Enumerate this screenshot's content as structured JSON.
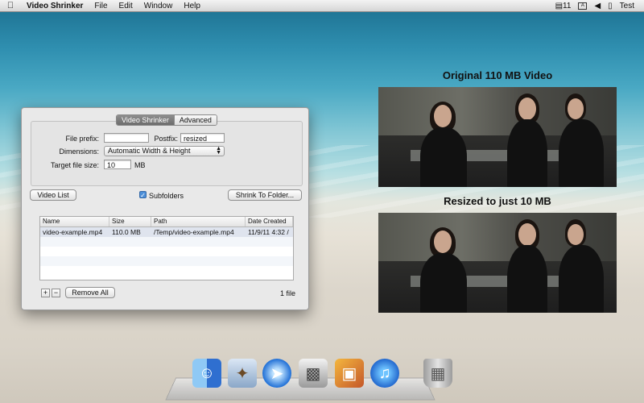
{
  "menubar": {
    "app_name": "Video Shrinker",
    "menus": [
      "File",
      "Edit",
      "Window",
      "Help"
    ],
    "status": {
      "input_label": "11",
      "user": "Test"
    }
  },
  "window": {
    "tabs": [
      "Video Shrinker",
      "Advanced"
    ],
    "active_tab": "Video Shrinker",
    "file_prefix_label": "File prefix:",
    "file_prefix_value": "",
    "postfix_label": "Postfix:",
    "postfix_value": "resized",
    "dimensions_label": "Dimensions:",
    "dimensions_value": "Automatic Width & Height",
    "target_size_label": "Target file size:",
    "target_size_value": "10",
    "target_size_unit": "MB",
    "video_list_button": "Video List",
    "subfolders_label": "Subfolders",
    "subfolders_checked": true,
    "shrink_button": "Shrink To Folder...",
    "list": {
      "columns": [
        "Name",
        "Size",
        "Path",
        "Date Created"
      ],
      "rows": [
        {
          "name": "video-example.mp4",
          "size": "110.0 MB",
          "path": "/Temp/video-example.mp4",
          "date": "11/9/11 4:32 /"
        }
      ]
    },
    "add_label": "+",
    "remove_small_label": "−",
    "remove_all_button": "Remove All",
    "file_count": "1 file"
  },
  "promo": {
    "original_caption": "Original 110 MB Video",
    "resized_caption": "Resized to just 10 MB"
  },
  "dock": {
    "icons": [
      "finder-icon",
      "mail-icon",
      "safari-icon",
      "video-shrinker-icon",
      "iphoto-icon",
      "itunes-icon",
      "trash-icon"
    ]
  }
}
